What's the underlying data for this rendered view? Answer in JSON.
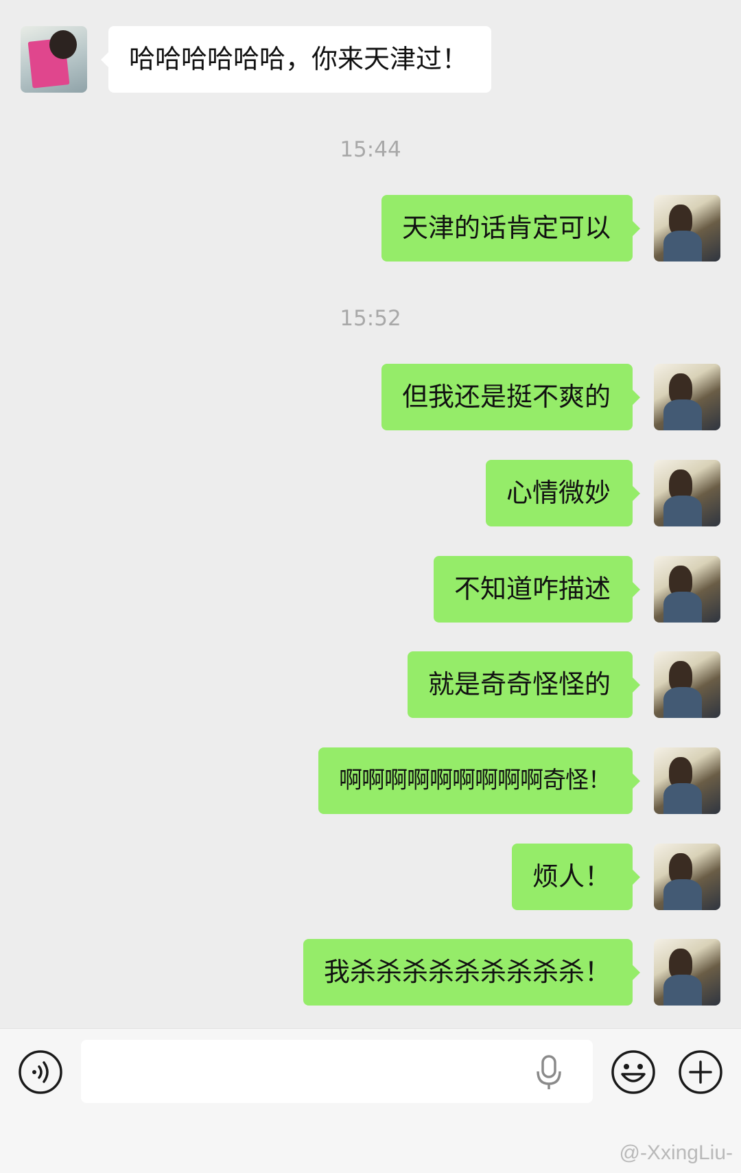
{
  "messages": [
    {
      "side": "other",
      "text": "哈哈哈哈哈哈，你来天津过！"
    },
    {
      "time": "15:44"
    },
    {
      "side": "me",
      "text": "天津的话肯定可以"
    },
    {
      "time": "15:52"
    },
    {
      "side": "me",
      "text": "但我还是挺不爽的"
    },
    {
      "side": "me",
      "text": "心情微妙"
    },
    {
      "side": "me",
      "text": "不知道咋描述"
    },
    {
      "side": "me",
      "text": "就是奇奇怪怪的"
    },
    {
      "side": "me",
      "text": "啊啊啊啊啊啊啊啊啊奇怪！"
    },
    {
      "side": "me",
      "text": "烦人！"
    },
    {
      "side": "me",
      "text": "我杀杀杀杀杀杀杀杀杀！"
    }
  ],
  "input_bar": {
    "voice_icon": "voice-mode-icon",
    "mic_icon": "microphone-icon",
    "emoji_icon": "emoji-icon",
    "plus_icon": "plus-icon",
    "input_value": ""
  },
  "watermark": "@-XxingLiu-",
  "colors": {
    "my_bubble": "#95ec69",
    "other_bubble": "#ffffff",
    "background": "#ededed"
  }
}
